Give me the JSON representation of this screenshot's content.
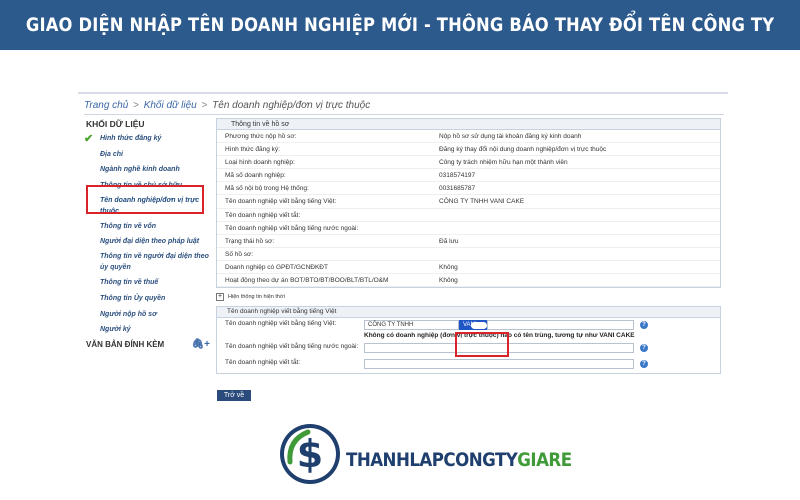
{
  "banner": {
    "title": "GIAO DIỆN NHẬP TÊN DOANH NGHIỆP MỚI - THÔNG BÁO THAY ĐỔI TÊN CÔNG TY"
  },
  "breadcrumb": {
    "home": "Trang chủ",
    "sep": ">",
    "data": "Khối dữ liệu",
    "current": "Tên doanh nghiệp/đơn vị trực thuộc"
  },
  "sidebar": {
    "section1": "KHỐI DỮ LIỆU",
    "items": [
      "Hình thức đăng ký",
      "Địa chỉ",
      "Ngành nghề kinh doanh",
      "Thông tin về chủ sở hữu",
      "Tên doanh nghiệp/đơn vị trực thuộc",
      "Thông tin về vốn",
      "Người đại diện theo pháp luật",
      "Thông tin về người đại diện theo ủy quyền",
      "Thông tin về thuế",
      "Thông tin Ủy quyền",
      "Người nộp hồ sơ",
      "Người ký"
    ],
    "section2": "VĂN BẢN ĐÍNH KÈM",
    "attach_icon": "paperclip-plus-icon"
  },
  "info": {
    "legend": "Thông tin về hồ sơ",
    "rows": [
      {
        "label": "Phương thức nộp hồ sơ:",
        "value": "Nộp hồ sơ sử dụng tài khoản đăng ký kinh doanh"
      },
      {
        "label": "Hình thức đăng ký:",
        "value": "Đăng ký thay đổi nội dung doanh nghiệp/đơn vị trực thuộc"
      },
      {
        "label": "Loại hình doanh nghiệp:",
        "value": "Công ty trách nhiệm hữu hạn một thành viên"
      },
      {
        "label": "Mã số doanh nghiệp:",
        "value": "0318574197"
      },
      {
        "label": "Mã số nội bộ trong Hệ thống:",
        "value": "0031685787"
      },
      {
        "label": "Tên doanh nghiệp viết bằng tiếng Việt:",
        "value": "CÔNG TY TNHH VANI CAKE"
      },
      {
        "label": "Tên doanh nghiệp viết tắt:",
        "value": ""
      },
      {
        "label": "Tên doanh nghiệp viết bằng tiếng nước ngoài:",
        "value": ""
      },
      {
        "label": "Trạng thái hồ sơ:",
        "value": "Đã lưu"
      },
      {
        "label": "Số hồ sơ:",
        "value": ""
      },
      {
        "label": "Doanh nghiệp có GPĐT/GCNĐKĐT",
        "value": "Không"
      },
      {
        "label": "Hoạt động theo dự án BOT/BTO/BT/BOO/BLT/BTL/O&M",
        "value": "Không"
      }
    ]
  },
  "toggle": {
    "symbol": "+",
    "label": "Hiện thông tin hiện thời"
  },
  "name_form": {
    "legend": "Tên doanh nghiệp viết bằng tiếng Việt",
    "vn_label": "Tên doanh nghiệp viết bằng tiếng Việt:",
    "vn_prefix": "CÔNG TY TNHH",
    "vn_selected": "VANI",
    "hint": "Không có doanh nghiệp (đơn vị trực thuộc) nào có tên trùng, tương tự như VANI CAKE",
    "foreign_label": "Tên doanh nghiệp viết bằng tiếng nước ngoài:",
    "foreign_value": "",
    "abbr_label": "Tên doanh nghiệp viết tắt:",
    "abbr_value": "",
    "help_symbol": "?"
  },
  "back_button": {
    "label": "Trở về"
  },
  "logo": {
    "part1": "THANHLAPCONGTY",
    "part2": "GIARE"
  },
  "colors": {
    "banner": "#2d5a8c",
    "highlight": "#d9232a",
    "logo_blue": "#1f3f6e",
    "logo_green": "#3f9a37"
  }
}
